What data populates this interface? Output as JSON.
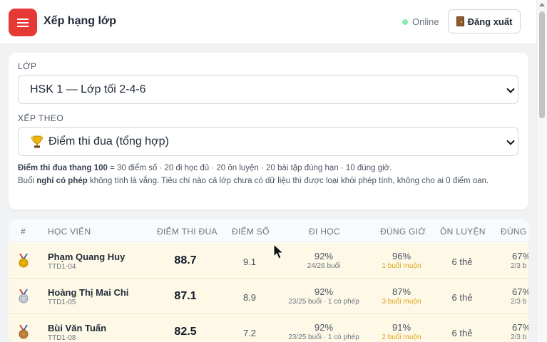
{
  "header": {
    "title": "Xếp hạng lớp",
    "status": "Online",
    "logout_label": "Đăng xuất",
    "accent": "#e53935"
  },
  "filters": {
    "class_label": "LỚP",
    "class_value": "HSK 1 — Lớp tối 2-4-6",
    "sort_label": "XẾP THEO",
    "sort_value": "Điểm thi đua (tổng hợp)",
    "note_line1_bold": "Điểm thi đua thang 100",
    "note_line1_rest": " = 30 điểm số · 20 đi học đủ · 20 ôn luyện · 20 bài tập đúng hạn · 10 đúng giờ.",
    "note_line2_pre": "Buổi ",
    "note_line2_bold": "nghỉ có phép",
    "note_line2_rest": " không tính là vắng. Tiêu chí nào cả lớp chưa có dữ liệu thì được loại khỏi phép tính, không cho ai 0 điểm oan."
  },
  "table": {
    "headers": {
      "rank": "#",
      "student": "HỌC VIÊN",
      "score": "ĐIỂM THI ĐUA",
      "grade": "ĐIỂM SỐ",
      "attendance": "ĐI HỌC",
      "punctual": "ĐÚNG GIỜ",
      "practice": "ÔN LUYỆN",
      "homework": "ĐÚNG"
    },
    "rows": [
      {
        "medal": "gold",
        "name": "Phạm Quang Huy",
        "code": "TTD1-04",
        "score": "88.7",
        "grade": "9.1",
        "att_pct": "92%",
        "att_sub": "24/26 buổi",
        "time_pct": "96%",
        "time_sub": "1 buổi muộn",
        "practice": "6 thẻ",
        "hw_pct": "67%",
        "hw_sub": "2/3 b"
      },
      {
        "medal": "silver",
        "name": "Hoàng Thị Mai Chi",
        "code": "TTD1-05",
        "score": "87.1",
        "grade": "8.9",
        "att_pct": "92%",
        "att_sub": "23/25 buổi · 1 có phép",
        "time_pct": "87%",
        "time_sub": "3 buổi muộn",
        "practice": "6 thẻ",
        "hw_pct": "67%",
        "hw_sub": "2/3 b"
      },
      {
        "medal": "bronze",
        "name": "Bùi Văn Tuấn",
        "code": "TTD1-08",
        "score": "82.5",
        "grade": "7.2",
        "att_pct": "92%",
        "att_sub": "23/25 buổi · 1 có phép",
        "time_pct": "91%",
        "time_sub": "2 buổi muộn",
        "practice": "6 thẻ",
        "hw_pct": "67%",
        "hw_sub": "2/3 b"
      }
    ]
  }
}
